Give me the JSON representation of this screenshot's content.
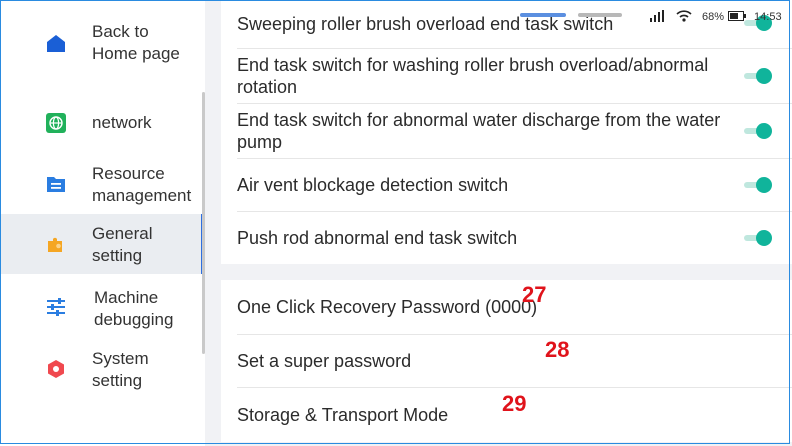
{
  "sidebar": {
    "items": [
      {
        "label": "Back to\nHome page",
        "icon": "home-icon"
      },
      {
        "label": "network",
        "icon": "globe-icon"
      },
      {
        "label": "Resource\nmanagement",
        "icon": "folder-icon"
      },
      {
        "label": "General\nsetting",
        "icon": "puzzle-icon"
      },
      {
        "label": "Machine\ndebugging",
        "icon": "sliders-icon"
      },
      {
        "label": "System\nsetting",
        "icon": "hexagon-icon"
      }
    ]
  },
  "switches": [
    {
      "label": "Sweeping roller brush overload end task switch",
      "on": true
    },
    {
      "label": "End task switch for washing roller brush overload/abnormal rotation",
      "on": true
    },
    {
      "label": "End task switch for abnormal water discharge from the water pump",
      "on": true
    },
    {
      "label": "Air vent blockage detection switch",
      "on": true
    },
    {
      "label": "Push rod abnormal end task switch",
      "on": true
    }
  ],
  "settings": [
    {
      "label": "One Click Recovery Password (0000)",
      "marker": "27"
    },
    {
      "label": "Set a super password",
      "marker": "28"
    },
    {
      "label": "Storage & Transport Mode",
      "marker": "29"
    }
  ],
  "status_bar": {
    "battery": "68%",
    "time": "14:53"
  },
  "colors": {
    "toggle_on": "#10b49b",
    "active_accent": "#2f6fe0",
    "marker": "#e0131b"
  }
}
